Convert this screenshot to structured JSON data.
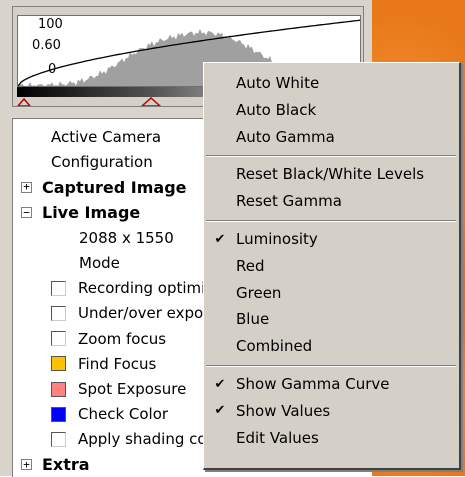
{
  "histogram": {
    "labels": {
      "max": "100",
      "gamma": "0.60",
      "min": "0"
    },
    "black_point": 0.0,
    "gamma_point": 0.39
  },
  "tree": {
    "rows": [
      {
        "label": "Active Camera",
        "kind": "text"
      },
      {
        "label": "Configuration",
        "kind": "text"
      },
      {
        "label": "Captured Image",
        "kind": "group",
        "expander": "+"
      },
      {
        "label": "Live Image",
        "kind": "group",
        "expander": "−"
      },
      {
        "label": "2088 x 1550",
        "kind": "text"
      },
      {
        "label": "Mode",
        "kind": "text"
      },
      {
        "label": "Recording optimi",
        "kind": "check"
      },
      {
        "label": "Under/over expo",
        "kind": "check"
      },
      {
        "label": "Zoom focus",
        "kind": "check"
      },
      {
        "label": "Find Focus",
        "kind": "swatch",
        "color": "#ffc000"
      },
      {
        "label": "Spot Exposure",
        "kind": "swatch",
        "color": "#ff8080"
      },
      {
        "label": "Check Color",
        "kind": "swatch",
        "color": "#0000ff"
      },
      {
        "label": "Apply shading co",
        "kind": "check"
      },
      {
        "label": "Extra",
        "kind": "group",
        "expander": "+"
      }
    ]
  },
  "context_menu": {
    "groups": [
      [
        {
          "label": "Auto White",
          "checked": false
        },
        {
          "label": "Auto Black",
          "checked": false
        },
        {
          "label": "Auto Gamma",
          "checked": false
        }
      ],
      [
        {
          "label": "Reset Black/White Levels",
          "checked": false
        },
        {
          "label": "Reset Gamma",
          "checked": false
        }
      ],
      [
        {
          "label": "Luminosity",
          "checked": true
        },
        {
          "label": "Red",
          "checked": false
        },
        {
          "label": "Green",
          "checked": false
        },
        {
          "label": "Blue",
          "checked": false
        },
        {
          "label": "Combined",
          "checked": false
        }
      ],
      [
        {
          "label": "Show Gamma Curve",
          "checked": true
        },
        {
          "label": "Show Values",
          "checked": true
        },
        {
          "label": "Edit Values",
          "checked": false
        }
      ]
    ],
    "check_glyph": "✔"
  }
}
